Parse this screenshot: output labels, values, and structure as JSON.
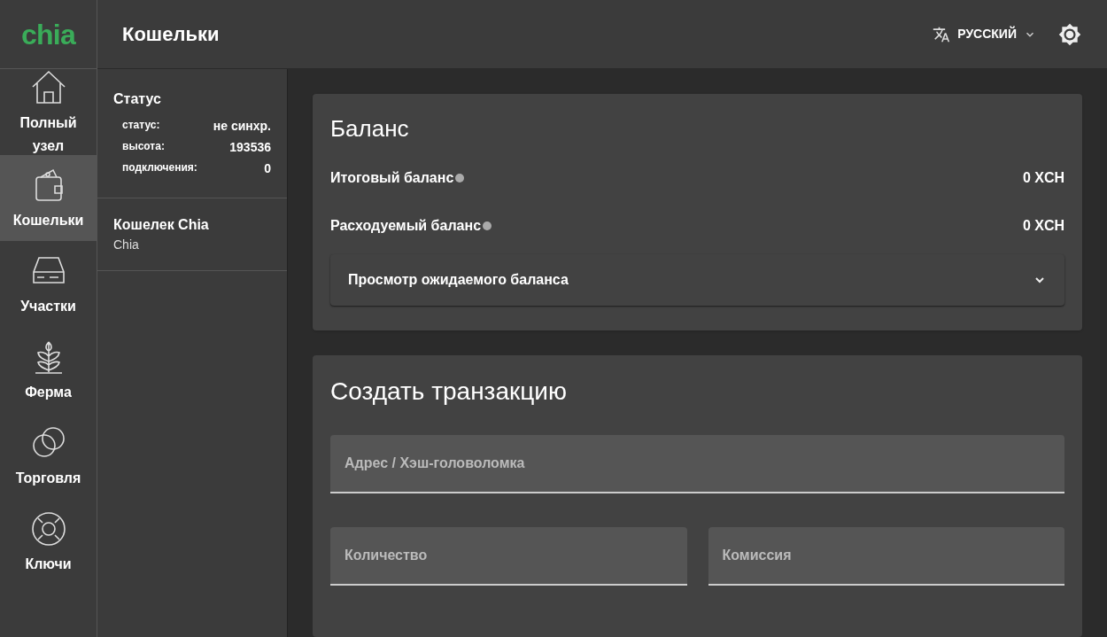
{
  "logo": "chia",
  "header": {
    "title": "Кошельки",
    "language": "РУССКИЙ"
  },
  "nav": [
    {
      "kind": "home",
      "label": "Полный узел",
      "selected": false
    },
    {
      "kind": "wallet",
      "label": "Кошельки",
      "selected": true
    },
    {
      "kind": "plots",
      "label": "Участки",
      "selected": false
    },
    {
      "kind": "farm",
      "label": "Ферма",
      "selected": false
    },
    {
      "kind": "trade",
      "label": "Торговля",
      "selected": false
    },
    {
      "kind": "keys",
      "label": "Ключи",
      "selected": false
    }
  ],
  "status": {
    "title": "Статус",
    "rows": [
      {
        "label": "статус:",
        "value": "не синхр."
      },
      {
        "label": "высота:",
        "value": "193536"
      },
      {
        "label": "подключения:",
        "value": "0"
      }
    ]
  },
  "wallets": [
    {
      "name": "Кошелек Chia",
      "type": "Chia"
    }
  ],
  "balance": {
    "title": "Баланс",
    "rows": [
      {
        "label": "Итоговый баланс",
        "value": "0 XCH"
      },
      {
        "label": "Расходуемый баланс",
        "value": "0 XCH"
      }
    ],
    "pending": {
      "label": "Просмотр ожидаемого баланса",
      "expanded": false
    }
  },
  "transaction": {
    "title": "Создать транзакцию",
    "address": {
      "placeholder": "Адрес / Хэш-головоломка"
    },
    "amount": {
      "placeholder": "Количество"
    },
    "fee": {
      "placeholder": "Комиссия"
    }
  }
}
